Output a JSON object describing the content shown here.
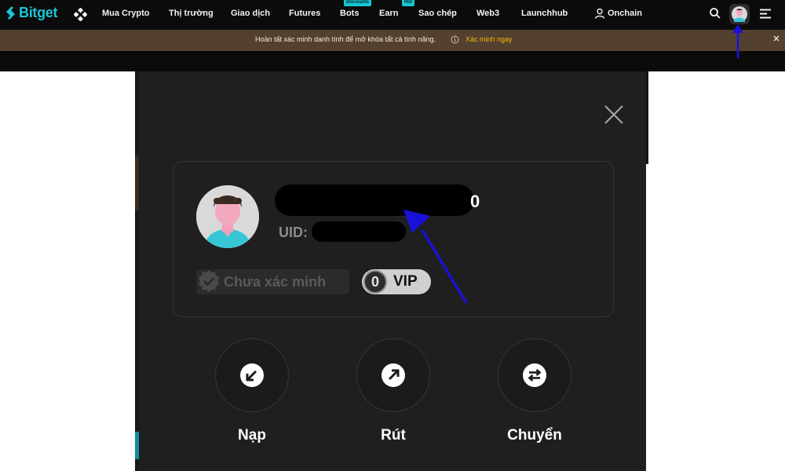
{
  "brand": {
    "name": "Bitget",
    "accent_color": "#19c5d6"
  },
  "topnav": {
    "menu_icon": "grid-diamond-icon",
    "items": [
      {
        "label": "Mua Crypto",
        "badge": ""
      },
      {
        "label": "Thị trường",
        "badge": ""
      },
      {
        "label": "Giao dịch",
        "badge": ""
      },
      {
        "label": "Futures",
        "badge": ""
      },
      {
        "label": "Bots",
        "badge": "Discounts"
      },
      {
        "label": "Earn",
        "badge": "Hot"
      },
      {
        "label": "Sao chép",
        "badge": ""
      },
      {
        "label": "Web3",
        "badge": ""
      },
      {
        "label": "Launchhub",
        "badge": ""
      },
      {
        "label": "Onchain",
        "badge": ""
      }
    ],
    "right_icons": [
      "search-icon",
      "user-avatar",
      "hamburger-menu-icon"
    ]
  },
  "notice": {
    "text": "Hoàn tất xác minh danh tính để mở khóa tất cả tính năng.",
    "link": "Xác minh ngay",
    "background": "#54402f",
    "link_color": "#f0b90b"
  },
  "profile_popup": {
    "name_suffix": "0",
    "uid_label": "UID:",
    "verification_status": "Chưa xác minh",
    "vip_level": "0",
    "vip_label": "VIP",
    "actions": [
      {
        "label": "Nạp",
        "icon": "deposit-arrow-icon"
      },
      {
        "label": "Rút",
        "icon": "withdraw-arrow-icon"
      },
      {
        "label": "Chuyển",
        "icon": "transfer-icon"
      }
    ],
    "close_icon": "close-icon"
  },
  "annotation_color": "#1a10d8"
}
